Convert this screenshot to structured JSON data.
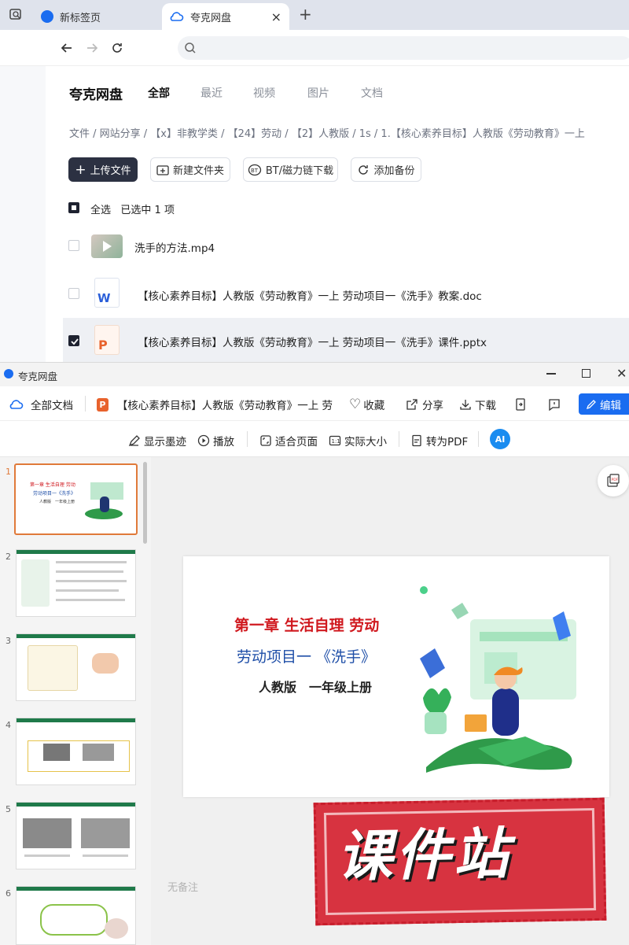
{
  "browser": {
    "tabs": [
      {
        "label": "新标签页"
      },
      {
        "label": "夸克网盘"
      }
    ],
    "new_tab": "+",
    "close": "×"
  },
  "drive": {
    "logo": "夸克网盘",
    "nav": [
      "全部",
      "最近",
      "视频",
      "图片",
      "文档"
    ],
    "breadcrumb": "文件 / 网站分享 / 【x】非教学类 / 【24】劳动 / 【2】人教版 / 1s / 1.【核心素养目标】人教版《劳动教育》一上",
    "buttons": {
      "upload": "上传文件",
      "new_folder": "新建文件夹",
      "bt": "BT/磁力链下载",
      "backup": "添加备份"
    },
    "select_all": "全选",
    "selected_info": "已选中 1 项",
    "files": [
      {
        "name": "洗手的方法.mp4",
        "type": "video",
        "checked": false
      },
      {
        "name": "【核心素养目标】人教版《劳动教育》一上 劳动项目一《洗手》教案.doc",
        "type": "word",
        "checked": false
      },
      {
        "name": "【核心素养目标】人教版《劳动教育》一上 劳动项目一《洗手》课件.pptx",
        "type": "ppt",
        "checked": true
      }
    ]
  },
  "viewer": {
    "window_title": "夸克网盘",
    "all_docs": "全部文档",
    "doc_title": "【核心素养目标】人教版《劳动教育》一上 劳",
    "actions": {
      "favorite": "收藏",
      "share": "分享",
      "download": "下载",
      "edit": "编辑"
    },
    "tools": {
      "ink": "显示墨迹",
      "play": "播放",
      "fit": "适合页面",
      "actual": "实际大小",
      "pdf": "转为PDF",
      "ai": "AI"
    },
    "thumb_numbers": [
      "1",
      "2",
      "3",
      "4",
      "5",
      "6"
    ],
    "note": "无备注",
    "slide": {
      "line1": "第一章 生活自理 劳动",
      "line2": "劳动项目一 《洗手》",
      "line3": "人教版　一年级上册"
    },
    "watermark": "课件站",
    "colors": {
      "accent_blue": "#1a6cf0",
      "slide_red": "#d0191f",
      "slide_blue": "#1f4fa8",
      "watermark_red": "#d73340"
    }
  }
}
